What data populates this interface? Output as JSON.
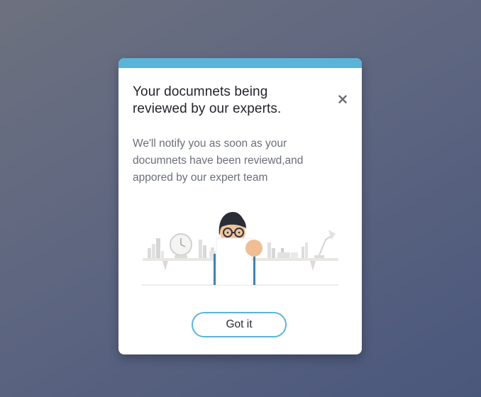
{
  "modal": {
    "title": "Your documnets being reviewed by our experts.",
    "message": "We'll notify you as soon as your documnets have been reviewd,and appored by our expert team",
    "confirm_label": "Got it",
    "close_icon": "close-icon",
    "illustration": "reviewer-at-desk-illustration"
  },
  "colors": {
    "accent": "#5ab4d9",
    "title_text": "#23252b",
    "body_text": "#6b6f78",
    "background_start": "#6d717f",
    "background_end": "#4a577c"
  }
}
